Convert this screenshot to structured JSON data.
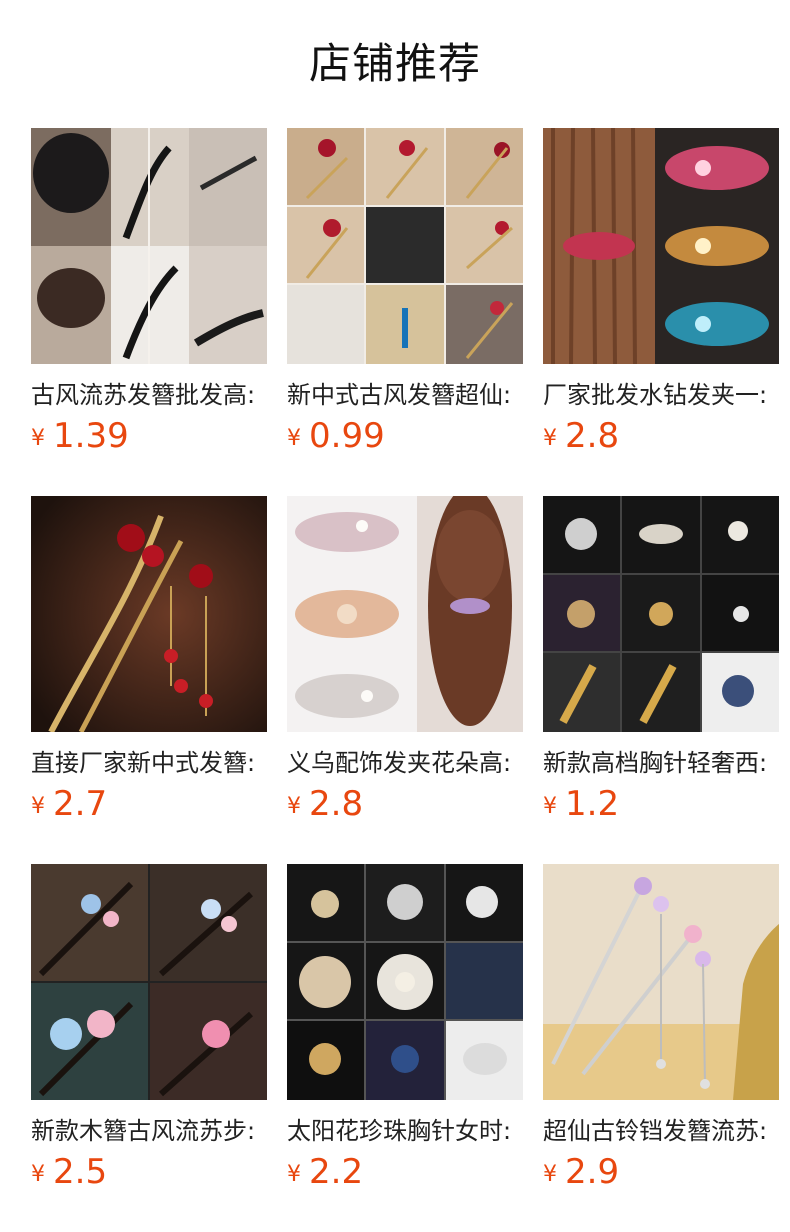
{
  "section": {
    "title": "店铺推荐"
  },
  "products": [
    {
      "name": "古风流苏发簪批发高:",
      "currency": "¥",
      "price": "1.39",
      "image": "hairpin-collage-black-stick"
    },
    {
      "name": "新中式古风发簪超仙:",
      "currency": "¥",
      "price": "0.99",
      "image": "hairpin-collage-red-flower"
    },
    {
      "name": "厂家批发水钻发夹一:",
      "currency": "¥",
      "price": "2.8",
      "image": "rhinestone-barrette"
    },
    {
      "name": "直接厂家新中式发簪:",
      "currency": "¥",
      "price": "2.7",
      "image": "red-plum-hairpin"
    },
    {
      "name": "义乌配饰发夹花朵高:",
      "currency": "¥",
      "price": "2.8",
      "image": "pearl-barrette"
    },
    {
      "name": "新款高档胸针轻奢西:",
      "currency": "¥",
      "price": "1.2",
      "image": "brooch-collage"
    },
    {
      "name": "新款木簪古风流苏步:",
      "currency": "¥",
      "price": "2.5",
      "image": "wooden-hairpin-flowers"
    },
    {
      "name": "太阳花珍珠胸针女时:",
      "currency": "¥",
      "price": "2.2",
      "image": "sunflower-pearl-brooch"
    },
    {
      "name": "超仙古铃铛发簪流苏:",
      "currency": "¥",
      "price": "2.9",
      "image": "silver-bell-hairpin"
    }
  ]
}
